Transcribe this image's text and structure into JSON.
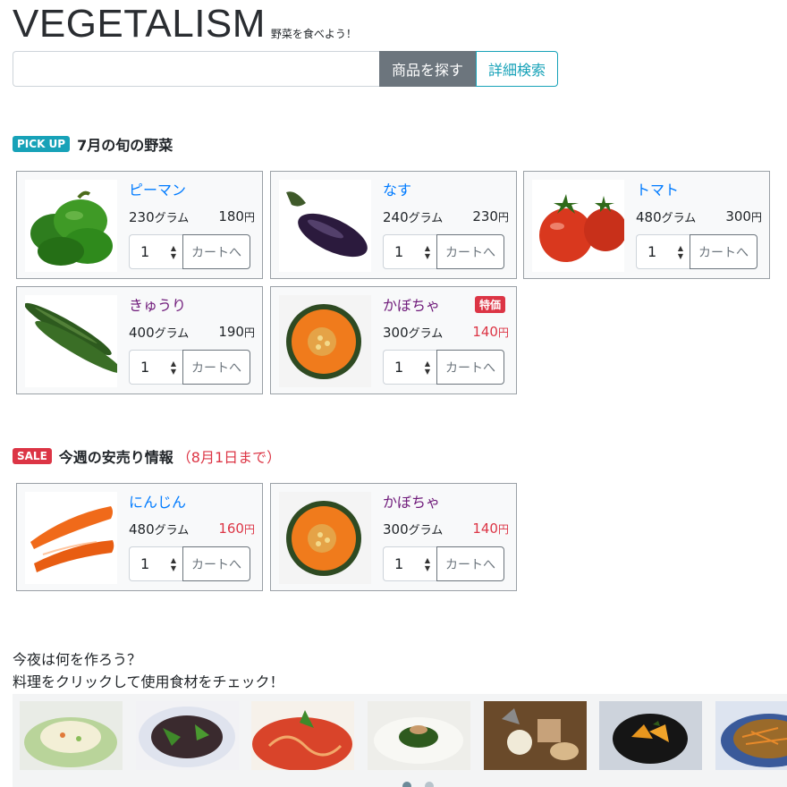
{
  "header": {
    "logo": "VEGETALISM",
    "tagline": "野菜を食べよう！"
  },
  "search": {
    "placeholder": "",
    "value": "",
    "submit_label": "商品を探す",
    "advanced_label": "詳細検索"
  },
  "pickup": {
    "badge": "PICK UP",
    "title": "7月の旬の野菜",
    "items": [
      {
        "name": "ピーマン",
        "weight": "230",
        "weight_unit": "グラム",
        "price": "180",
        "price_unit": "円",
        "qty": "1",
        "cart_label": "カートへ",
        "image": "green-pepper-image"
      },
      {
        "name": "なす",
        "weight": "240",
        "weight_unit": "グラム",
        "price": "230",
        "price_unit": "円",
        "qty": "1",
        "cart_label": "カートへ",
        "image": "eggplant-image"
      },
      {
        "name": "トマト",
        "weight": "480",
        "weight_unit": "グラム",
        "price": "300",
        "price_unit": "円",
        "qty": "1",
        "cart_label": "カートへ",
        "image": "tomato-image"
      },
      {
        "name": "きゅうり",
        "weight": "400",
        "weight_unit": "グラム",
        "price": "190",
        "price_unit": "円",
        "qty": "1",
        "cart_label": "カートへ",
        "image": "cucumber-image"
      },
      {
        "name": "かぼちゃ",
        "weight": "300",
        "weight_unit": "グラム",
        "price": "140",
        "price_unit": "円",
        "qty": "1",
        "cart_label": "カートへ",
        "special": "特価",
        "image": "pumpkin-image"
      }
    ]
  },
  "sale": {
    "badge": "SALE",
    "title": "今週の安売り情報",
    "note": "（8月1日まで）",
    "items": [
      {
        "name": "にんじん",
        "weight": "480",
        "weight_unit": "グラム",
        "price": "160",
        "price_unit": "円",
        "qty": "1",
        "cart_label": "カートへ",
        "image": "carrot-image"
      },
      {
        "name": "かぼちゃ",
        "weight": "300",
        "weight_unit": "グラム",
        "price": "140",
        "price_unit": "円",
        "qty": "1",
        "cart_label": "カートへ",
        "image": "pumpkin-image"
      }
    ]
  },
  "recipes": {
    "line1": "今夜は何を作ろう？",
    "line2": "料理をクリックして使用食材をチェック！",
    "dishes": [
      "salad-image",
      "eggplant-dish-image",
      "pasta-image",
      "spinach-dish-image",
      "oden-image",
      "simmered-pumpkin-image",
      "kinpira-image"
    ],
    "active_page": 1,
    "page_count": 2
  },
  "colors": {
    "link": "#007bff",
    "visited": "#6f1a7a",
    "sale": "#dc3545",
    "info": "#17a2b8",
    "secondary": "#6c757d"
  }
}
